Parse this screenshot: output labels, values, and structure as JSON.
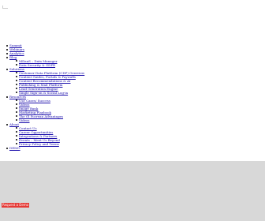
{
  "logo": {
    "icon": "logo-icon"
  },
  "nav": {
    "items": [
      {
        "label": "Summit"
      },
      {
        "label": "Webinars"
      },
      {
        "label": "Analytics"
      },
      {
        "label": "Blog",
        "sub": [
          "MDaaS – Data Manager",
          "Data Security & GDPR"
        ]
      },
      {
        "label": "Solutions",
        "sub": [
          "Customer Data Platform (CDP) Overview",
          "Content Guides, Portals & Paywalls",
          "Content Recommendations & AI",
          "Publishing & Mail Platform",
          "Lead Generation Engine",
          "Single Sign-on & Social Log-in"
        ]
      },
      {
        "label": "Resources",
        "sub": [
          "Use Cases/ Success",
          "Videos",
          "Image Bank",
          "Marketing Playbook",
          "The Ol Pocrean Advantages",
          "Videos"
        ]
      },
      {
        "label": "About",
        "sub": [
          "Contact Us",
          "Career Opportunities",
          "Integrations & Partners",
          "Events – Meet Us Beyond",
          "Privacy Policy and Terms"
        ]
      },
      {
        "label": "DEMO"
      }
    ]
  },
  "hero": {
    "cta_label": "Request a Demo"
  },
  "colors": {
    "cta_background": "#e53935",
    "hero_background": "#d8d8d8",
    "link": "#1a0dab"
  }
}
